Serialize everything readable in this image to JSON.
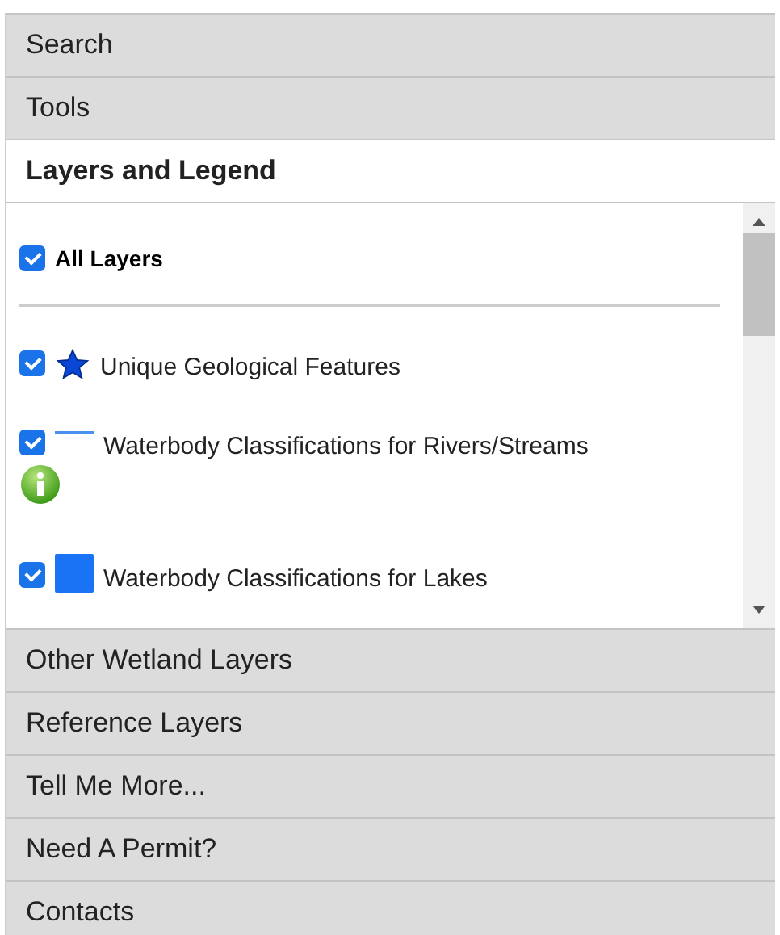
{
  "sections": [
    {
      "label": "Search",
      "expanded": false
    },
    {
      "label": "Tools",
      "expanded": false
    },
    {
      "label": "Layers and Legend",
      "expanded": true
    },
    {
      "label": "Other Wetland Layers",
      "expanded": false
    },
    {
      "label": "Reference Layers",
      "expanded": false
    },
    {
      "label": "Tell Me More...",
      "expanded": false
    },
    {
      "label": "Need A Permit?",
      "expanded": false
    },
    {
      "label": "Contacts",
      "expanded": false
    }
  ],
  "all_layers": {
    "label": "All Layers",
    "checked": true
  },
  "layers": [
    {
      "label": "Unique Geological Features",
      "checked": true,
      "kind": "star",
      "info": false
    },
    {
      "label": "Waterbody Classifications for Rivers/Streams",
      "checked": true,
      "kind": "line",
      "info": true
    },
    {
      "label": "Waterbody Classifications for Lakes",
      "checked": true,
      "kind": "square",
      "info": false
    }
  ]
}
